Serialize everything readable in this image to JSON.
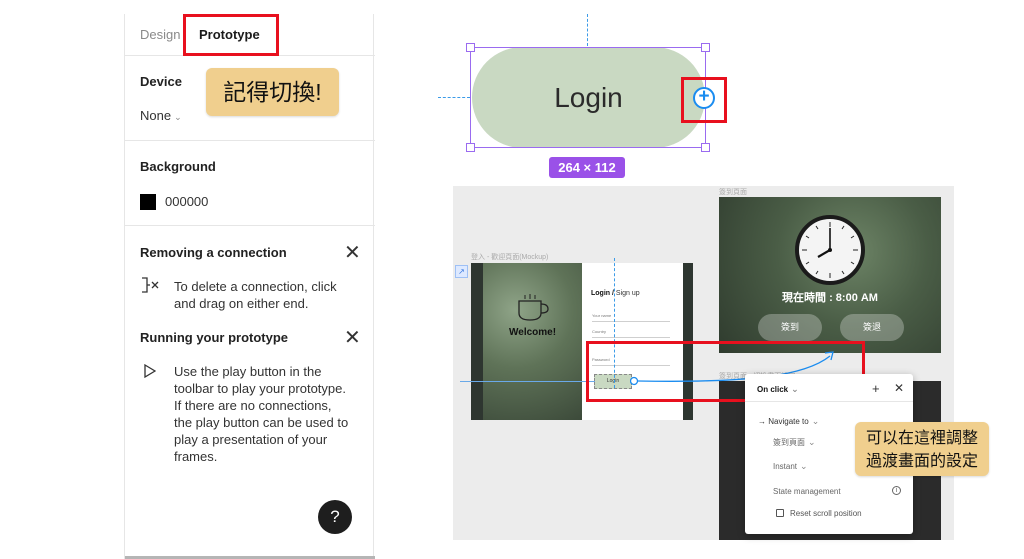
{
  "panel": {
    "tabs": {
      "design": "Design",
      "prototype": "Prototype"
    },
    "device": {
      "title": "Device",
      "value": "None"
    },
    "background": {
      "title": "Background",
      "hex": "000000",
      "swatch_color": "#000000"
    },
    "removing": {
      "title": "Removing a connection",
      "text_line1": "To delete a connection, click",
      "text_line2": "and drag on either end."
    },
    "running": {
      "title": "Running your prototype",
      "lines": [
        "Use the play button in the",
        "toolbar to play your prototype.",
        "If there are no connections,",
        "the play button can be used to",
        "play a presentation of your",
        "frames."
      ]
    },
    "help_label": "?"
  },
  "callouts": {
    "switch_reminder": "記得切換!",
    "transition_line1": "可以在這裡調整",
    "transition_line2": "過渡畫面的設定"
  },
  "login_button": {
    "label": "Login",
    "dimensions": "264 × 112",
    "add_symbol": "+"
  },
  "canvas": {
    "frame_labels": {
      "mockup": "登入 - 歡迎頁面(Mockup)",
      "clock_frame": "簽到頁面",
      "dark_frame": "簽到頁面 - 切換畫面設定"
    },
    "mockup": {
      "welcome": "Welcome!",
      "title_login": "Login /",
      "title_signup": " Sign up",
      "fields": [
        "Your name",
        "Country",
        "Password"
      ],
      "login_label": "Login"
    },
    "clock_screen": {
      "time_text": "現在時間 : 8:00 AM",
      "checkin": "簽到",
      "checkout": "簽退"
    }
  },
  "popup": {
    "trigger": "On click",
    "action": "Navigate to",
    "destination": "簽到頁面",
    "animation": "Instant",
    "state_management": "State management",
    "reset_scroll": "Reset scroll position"
  },
  "colors": {
    "highlight_red": "#e8101e",
    "callout_bg": "#f0cf8e",
    "selection_purple": "#9a6bf0",
    "prototype_blue": "#1a8cf0"
  }
}
